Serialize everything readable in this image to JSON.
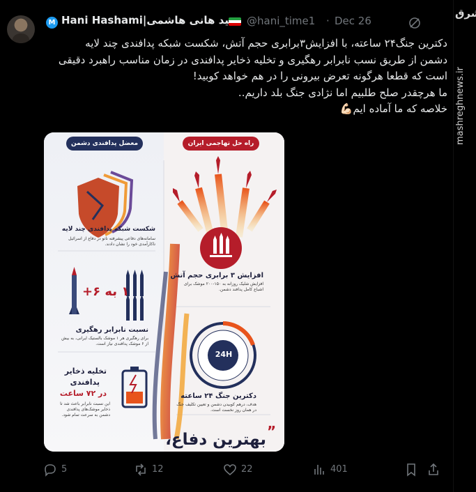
{
  "tweet": {
    "name": "Hani Hashami|سید هانی هاشمی",
    "handle": "@hani_time1",
    "dot": "·",
    "date": "Dec 26",
    "verified_badge": "M",
    "lines": [
      "دکترین جنگ۲۴ ساعته، با افزایش۳برابری حجم آتش، شکست شبکه پدافندی چند لایه",
      "دشمن از طریق نسب نابرابر رهگیری و تخلیه ذخایر پدافندی  در زمان مناسب راهبرد دقیقی",
      "است که قطعا هرگونه تعرض بیرونی را در هم خواهد کوبید!",
      "ما هرچقدر صلح طلبیم اما نژادی جنگ بلد داریم..",
      "خلاصه که ما آماده ایم💪🏻"
    ]
  },
  "side": {
    "logo": "مشرق",
    "url": "mashreghnews.ir"
  },
  "infographic": {
    "pill_right": "راه حل تهاجمی ایران",
    "pill_left": "معضل پدافندی دشمن",
    "s1_title": "شکست شبکه پدافندی چند لایه",
    "s1_sub": "سامانه‌های دفاعی پیشرفته ناتو در دفاع از اسرائیل ناکارآمدی خود را نشان دادند.",
    "s2_title": "افزایش ۳ برابری حجم آتش",
    "s2_sub": "افزایش شلیک روزانه به ۱۵۰-۲۰۰ موشک برای اشباع کامل پدافند دشمن.",
    "s3_big": "۱ به ۶+",
    "s3_title": "نسبت نابرابر رهگیری",
    "s3_sub": "برای رهگیری هر ۱ موشک بالستیک ایرانی، به بیش از ۶ موشک پدافندی نیاز است.",
    "clock_label": "24H",
    "s4_title": "دکترین جنگ ۲۴ ساعته",
    "s4_sub": "هدف، درهم کوبیدن دشمن و تعیین تکلیف جنگ در همان روز نخست است.",
    "s5_title_a": "تخلیه ذخایر",
    "s5_title_b": "پدافندی",
    "s5_title_c": "در ۷۲ ساعت",
    "s5_sub": "این نسبت نابرابر باعث شد تا ذخایر موشک‌های پدافندی دشمن به سرعت تمام شود.",
    "footer": "بهترین دفاع،"
  },
  "actions": {
    "reply_count": "5",
    "retweet_count": "12",
    "like_count": "22",
    "views_count": "401"
  },
  "colors": {
    "red": "#b51d2a",
    "navy": "#23305c",
    "accent_blue": "#1d9bf0",
    "muted": "#71767b"
  }
}
